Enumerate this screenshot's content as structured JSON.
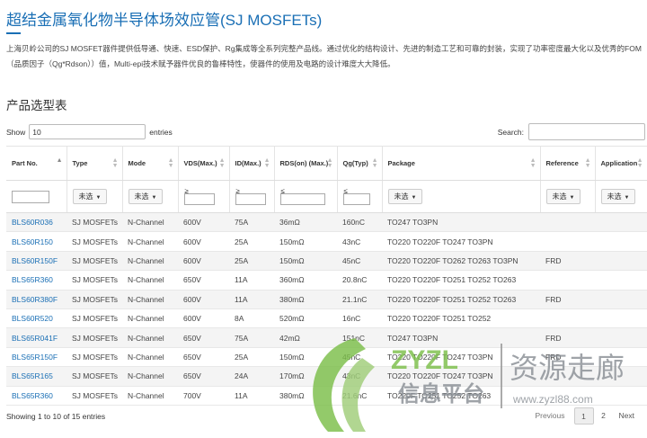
{
  "page": {
    "title": "超结金属氧化物半导体场效应管(SJ MOSFETs)",
    "description": "上海贝岭公司的SJ MOSFET器件提供低导通、快速、ESD保护、Rg集成等全系列完整产品线。通过优化的结构设计、先进的制造工艺和可靠的封装，实现了功率密度最大化以及优秀的FOM（品质因子（Qg*Rdson））值，Multi-epi技术赋予器件优良的鲁棒特性，使器件的使用及电路的设计难度大大降低。",
    "section_title": "产品选型表"
  },
  "controls": {
    "show_label": "Show",
    "show_value": "10",
    "entries_label": "entries",
    "search_label": "Search:"
  },
  "table": {
    "headers": [
      "Part No.",
      "Type",
      "Mode",
      "VDS(Max.)",
      "ID(Max.)",
      "RDS(on) (Max.)",
      "Qg(Typ)",
      "Package",
      "Reference",
      "Application"
    ],
    "filters": {
      "dropdown_label": "未选",
      "ge": "≥",
      "le": "≤"
    },
    "rows": [
      [
        "BLS60R036",
        "SJ MOSFETs",
        "N-Channel",
        "600V",
        "75A",
        "36mΩ",
        "160nC",
        "TO247 TO3PN",
        "",
        ""
      ],
      [
        "BLS60R150",
        "SJ MOSFETs",
        "N-Channel",
        "600V",
        "25A",
        "150mΩ",
        "43nC",
        "TO220 TO220F TO247 TO3PN",
        "",
        ""
      ],
      [
        "BLS60R150F",
        "SJ MOSFETs",
        "N-Channel",
        "600V",
        "25A",
        "150mΩ",
        "45nC",
        "TO220 TO220F TO262 TO263 TO3PN",
        "FRD",
        ""
      ],
      [
        "BLS65R360",
        "SJ MOSFETs",
        "N-Channel",
        "650V",
        "11A",
        "360mΩ",
        "20.8nC",
        "TO220 TO220F TO251 TO252 TO263",
        "",
        ""
      ],
      [
        "BLS60R380F",
        "SJ MOSFETs",
        "N-Channel",
        "600V",
        "11A",
        "380mΩ",
        "21.1nC",
        "TO220 TO220F TO251 TO252 TO263",
        "FRD",
        ""
      ],
      [
        "BLS60R520",
        "SJ MOSFETs",
        "N-Channel",
        "600V",
        "8A",
        "520mΩ",
        "16nC",
        "TO220 TO220F TO251 TO252",
        "",
        ""
      ],
      [
        "BLS65R041F",
        "SJ MOSFETs",
        "N-Channel",
        "650V",
        "75A",
        "42mΩ",
        "151nC",
        "TO247 TO3PN",
        "FRD",
        ""
      ],
      [
        "BLS65R150F",
        "SJ MOSFETs",
        "N-Channel",
        "650V",
        "25A",
        "150mΩ",
        "45nC",
        "TO220 TO220F TO247 TO3PN",
        "FRD",
        ""
      ],
      [
        "BLS65R165",
        "SJ MOSFETs",
        "N-Channel",
        "650V",
        "24A",
        "170mΩ",
        "43nC",
        "TO220 TO220F TO247 TO3PN",
        "",
        ""
      ],
      [
        "BLS65R360",
        "SJ MOSFETs",
        "N-Channel",
        "700V",
        "11A",
        "380mΩ",
        "21.6nC",
        "TO220F TO251 TO252 TO263",
        "",
        ""
      ]
    ]
  },
  "footer": {
    "info": "Showing 1 to 10 of 15 entries",
    "previous": "Previous",
    "page1": "1",
    "page2": "2",
    "next": "Next"
  },
  "watermark": {
    "brand": "ZYZL",
    "brand_cn": "资源走廊",
    "subtitle_cn": "信息平台",
    "url": "www.zyzl88.com",
    "colors": {
      "green": "#6db33f",
      "gray": "#9aa0a6"
    }
  }
}
